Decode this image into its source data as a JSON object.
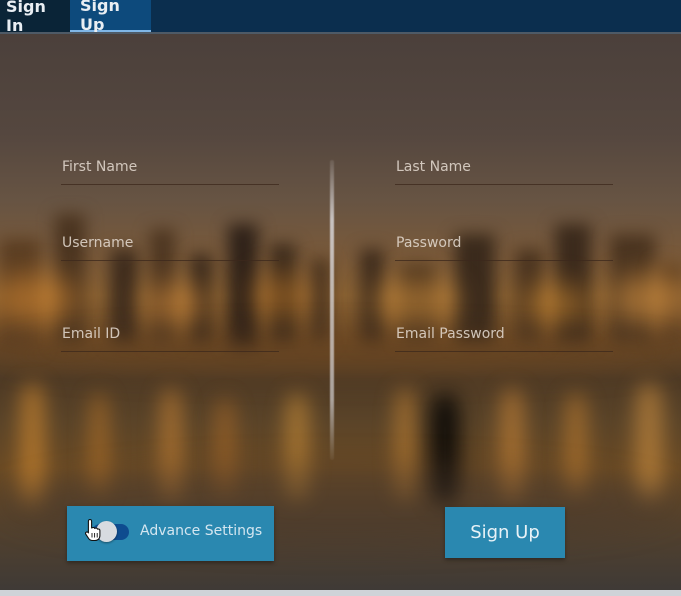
{
  "tabs": [
    {
      "label": "Sign In"
    },
    {
      "label": "Sign Up"
    }
  ],
  "active_tab": "Sign Up",
  "form": {
    "first_name": {
      "placeholder": "First Name",
      "value": ""
    },
    "last_name": {
      "placeholder": "Last Name",
      "value": ""
    },
    "username": {
      "placeholder": "Username",
      "value": ""
    },
    "password": {
      "placeholder": "Password",
      "value": ""
    },
    "email_id": {
      "placeholder": "Email ID",
      "value": ""
    },
    "email_password": {
      "placeholder": "Email Password",
      "value": ""
    }
  },
  "advance_settings": {
    "label": "Advance Settings",
    "toggle_state": "off"
  },
  "signup_button": {
    "label": "Sign Up"
  },
  "icons": {
    "cursor": "hand-pointer-icon"
  },
  "colors": {
    "tabbar": "#0b2e4e",
    "active_tab": "#0d4a7c",
    "button": "#2a88b0",
    "toggle": "#0e4c8f"
  }
}
